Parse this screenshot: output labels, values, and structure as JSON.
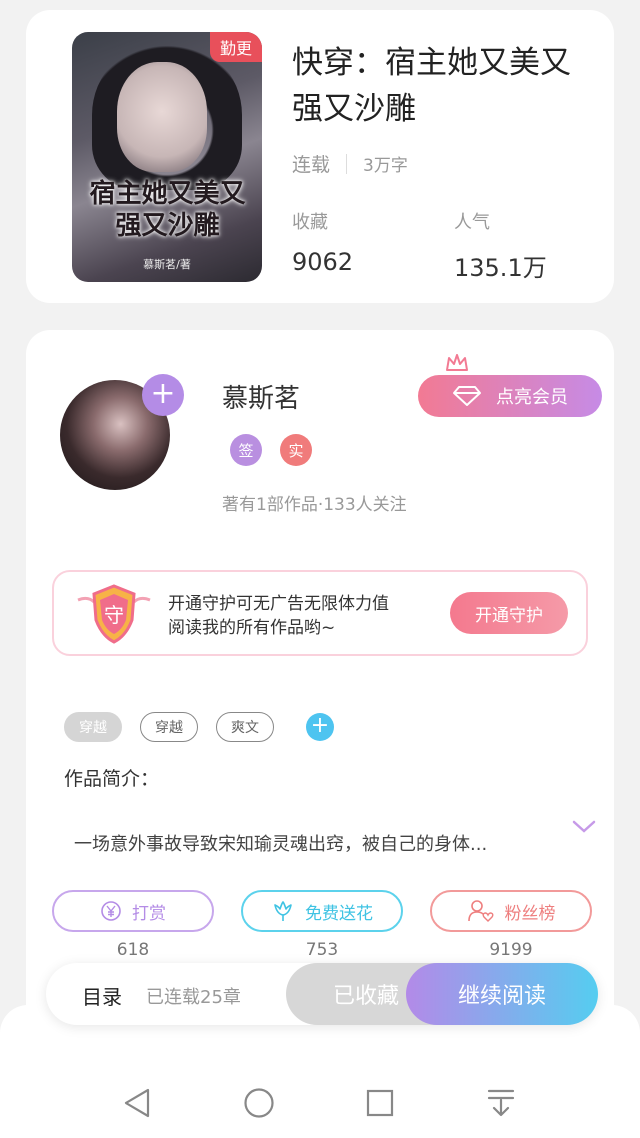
{
  "book": {
    "cover_badge": "勤更",
    "cover_title": "宿主她又美又强又沙雕",
    "cover_author": "慕斯茗/著",
    "title": "快穿：宿主她又美又强又沙雕",
    "status": "连载",
    "word_count": "3万字",
    "favorites_label": "收藏",
    "favorites_value": "9062",
    "popularity_label": "人气",
    "popularity_value": "135.1万"
  },
  "author": {
    "name": "慕斯茗",
    "badge_sign": "签",
    "badge_real": "实",
    "stats": "著有1部作品·133人关注",
    "vip_button": "点亮会员"
  },
  "guard": {
    "shield_char": "守",
    "line1": "开通守护可无广告无限体力值",
    "line2": "阅读我的所有作品哟~",
    "button": "开通守护"
  },
  "tags": [
    "穿越",
    "穿越",
    "爽文"
  ],
  "synopsis": {
    "label": "作品简介：",
    "text": "一场意外事故导致宋知瑜灵魂出窍，被自己的身体..."
  },
  "actions": {
    "reward_label": "打赏",
    "reward_count": "618",
    "flower_label": "免费送花",
    "flower_count": "753",
    "fans_label": "粉丝榜",
    "fans_count": "9199"
  },
  "read_bar": {
    "toc_label": "目录",
    "toc_status": "已连载25章",
    "collected": "已收藏",
    "continue": "继续阅读"
  },
  "colors": {
    "accent_purple": "#b48ce6",
    "accent_cyan": "#55cdf0",
    "accent_pink": "#f4798e"
  }
}
